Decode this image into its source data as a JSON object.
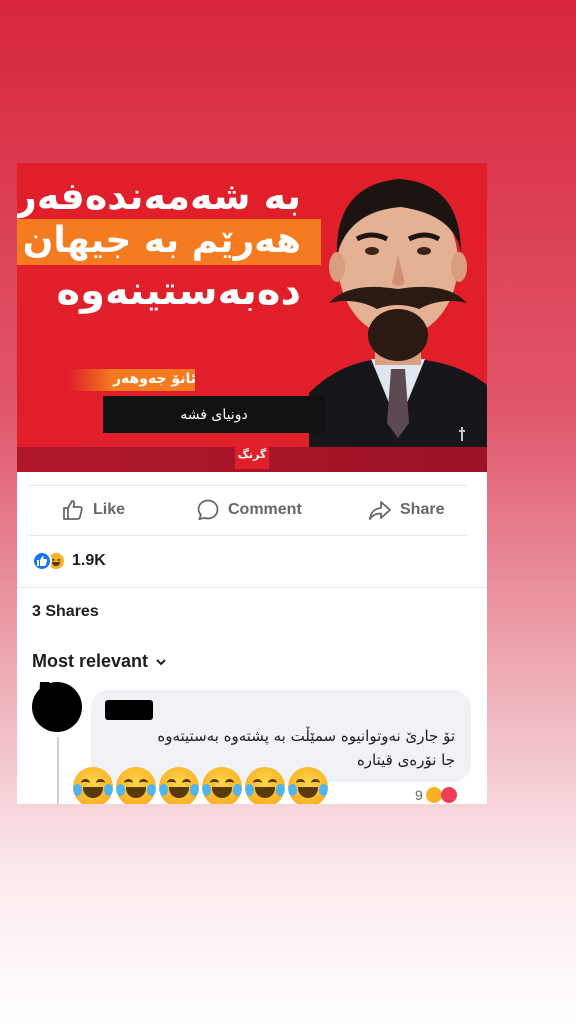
{
  "post": {
    "media": {
      "headline_line1": "بە شەمەندەفەر",
      "headline_line2": "هەرێم بە جیهان",
      "headline_line3": "دەبەستینەوە",
      "author": "ئانۆ جەوهەر",
      "subtitle": "دونیای فشە",
      "logo": "گرنگ"
    },
    "actions": {
      "like_label": "Like",
      "comment_label": "Comment",
      "share_label": "Share"
    },
    "reactions": {
      "count": "1.9K",
      "icons": [
        "like-icon",
        "haha-icon"
      ]
    },
    "shares_label": "3 Shares",
    "sort_label": "Most relevant"
  },
  "comment": {
    "text_line1": "تۆ جارێ نەوتوانیوە سمێڵت بە پشتەوە بەستیتەوە",
    "text_line2": "جا نۆرەی قیتارە",
    "emoji_count": 6,
    "emoji_icon": "laughing-with-tears-emoji",
    "reaction_count": "9",
    "reaction_icons": [
      "haha-icon",
      "love-icon"
    ]
  },
  "colors": {
    "brand_red": "#e01f2b",
    "accent_orange": "#f47b1f",
    "fb_blue": "#1877f2",
    "text_gray": "#65676b"
  }
}
